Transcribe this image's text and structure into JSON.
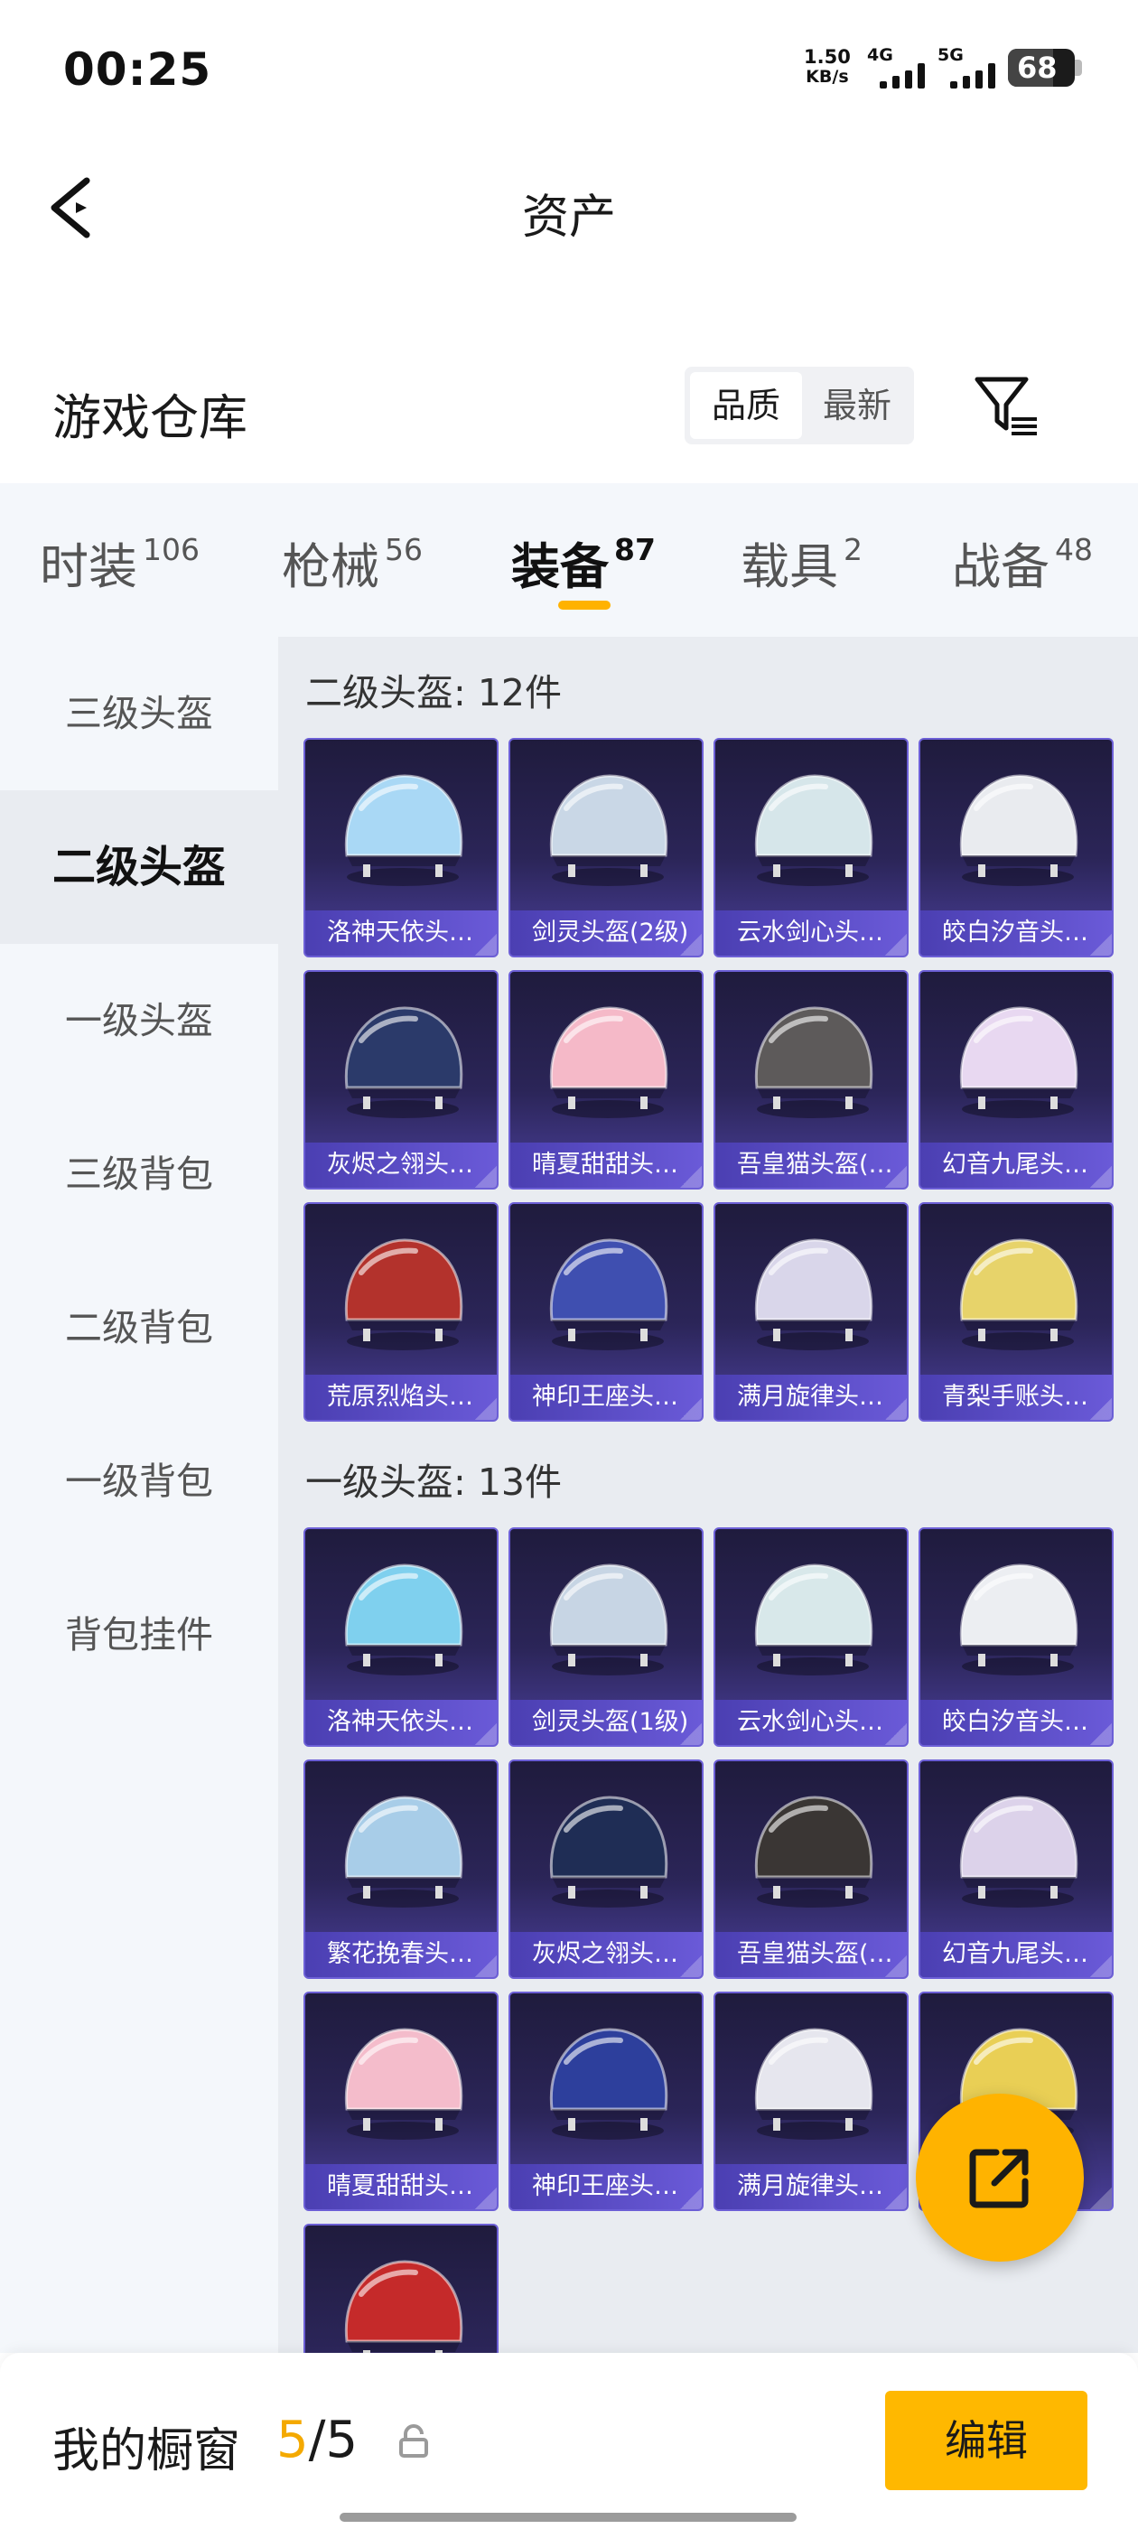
{
  "status_bar": {
    "time": "00:25",
    "net_speed_value": "1.50",
    "net_speed_unit": "KB/s",
    "signal_1_label": "4G",
    "signal_2_label": "5G",
    "battery": "68",
    "battery_level": 0.68
  },
  "header": {
    "title": "资产"
  },
  "section": {
    "title": "游戏仓库",
    "sort_quality": "品质",
    "sort_newest": "最新"
  },
  "tabs": [
    {
      "label": "时装",
      "count": "106"
    },
    {
      "label": "枪械",
      "count": "56"
    },
    {
      "label": "装备",
      "count": "87"
    },
    {
      "label": "载具",
      "count": "2"
    },
    {
      "label": "战备",
      "count": "48"
    }
  ],
  "side_menu": [
    {
      "label": "三级头盔"
    },
    {
      "label": "二级头盔"
    },
    {
      "label": "一级头盔"
    },
    {
      "label": "三级背包"
    },
    {
      "label": "二级背包"
    },
    {
      "label": "一级背包"
    },
    {
      "label": "背包挂件"
    }
  ],
  "groups": [
    {
      "title": "二级头盔: 12件",
      "items": [
        {
          "name": "洛神天依头…",
          "icon": "helmet-icon",
          "color": "#a9d8f5"
        },
        {
          "name": "剑灵头盔(2级)",
          "icon": "helmet-icon",
          "color": "#c9d7e6"
        },
        {
          "name": "云水剑心头…",
          "icon": "helmet-icon",
          "color": "#d6e6ea"
        },
        {
          "name": "皎白汐音头…",
          "icon": "helmet-icon",
          "color": "#e9ebef"
        },
        {
          "name": "灰烬之翎头…",
          "icon": "helmet-icon",
          "color": "#2b3a6a"
        },
        {
          "name": "晴夏甜甜头…",
          "icon": "helmet-icon",
          "color": "#f5b9c8"
        },
        {
          "name": "吾皇猫头盔(…",
          "icon": "helmet-icon",
          "color": "#5d5a5a"
        },
        {
          "name": "幻音九尾头…",
          "icon": "helmet-icon",
          "color": "#e8d8f1"
        },
        {
          "name": "荒原烈焰头…",
          "icon": "helmet-icon",
          "color": "#b3322c"
        },
        {
          "name": "神印王座头…",
          "icon": "helmet-icon",
          "color": "#3f4fb0"
        },
        {
          "name": "满月旋律头…",
          "icon": "helmet-icon",
          "color": "#d9d6ea"
        },
        {
          "name": "青梨手账头…",
          "icon": "helmet-icon",
          "color": "#e7d36a"
        }
      ]
    },
    {
      "title": "一级头盔: 13件",
      "items": [
        {
          "name": "洛神天依头…",
          "icon": "helmet-icon",
          "color": "#7fd0ee"
        },
        {
          "name": "剑灵头盔(1级)",
          "icon": "helmet-icon",
          "color": "#c7d5e4"
        },
        {
          "name": "云水剑心头…",
          "icon": "helmet-icon",
          "color": "#d8e8ea"
        },
        {
          "name": "皎白汐音头…",
          "icon": "helmet-icon",
          "color": "#eceef2"
        },
        {
          "name": "繁花挽春头…",
          "icon": "helmet-icon",
          "color": "#a8cde8"
        },
        {
          "name": "灰烬之翎头…",
          "icon": "helmet-icon",
          "color": "#1f2d55"
        },
        {
          "name": "吾皇猫头盔(…",
          "icon": "helmet-icon",
          "color": "#3a3634"
        },
        {
          "name": "幻音九尾头…",
          "icon": "helmet-icon",
          "color": "#dcd2ea"
        },
        {
          "name": "晴夏甜甜头…",
          "icon": "helmet-icon",
          "color": "#f4bccb"
        },
        {
          "name": "神印王座头…",
          "icon": "helmet-icon",
          "color": "#2d3f9c"
        },
        {
          "name": "满月旋律头…",
          "icon": "helmet-icon",
          "color": "#e6e6ee"
        },
        {
          "name": "",
          "icon": "helmet-icon",
          "color": "#e9cf55"
        },
        {
          "name": "",
          "icon": "helmet-icon",
          "color": "#c52a2a"
        }
      ]
    }
  ],
  "bottom_bar": {
    "label": "我的橱窗",
    "current": "5",
    "separator": "/",
    "total": "5",
    "edit": "编辑"
  },
  "colors": {
    "accent": "#ffb800",
    "card_top": "#1f1b3d",
    "card_bottom": "#4a3f9a",
    "card_label": "#5a4cc6"
  }
}
